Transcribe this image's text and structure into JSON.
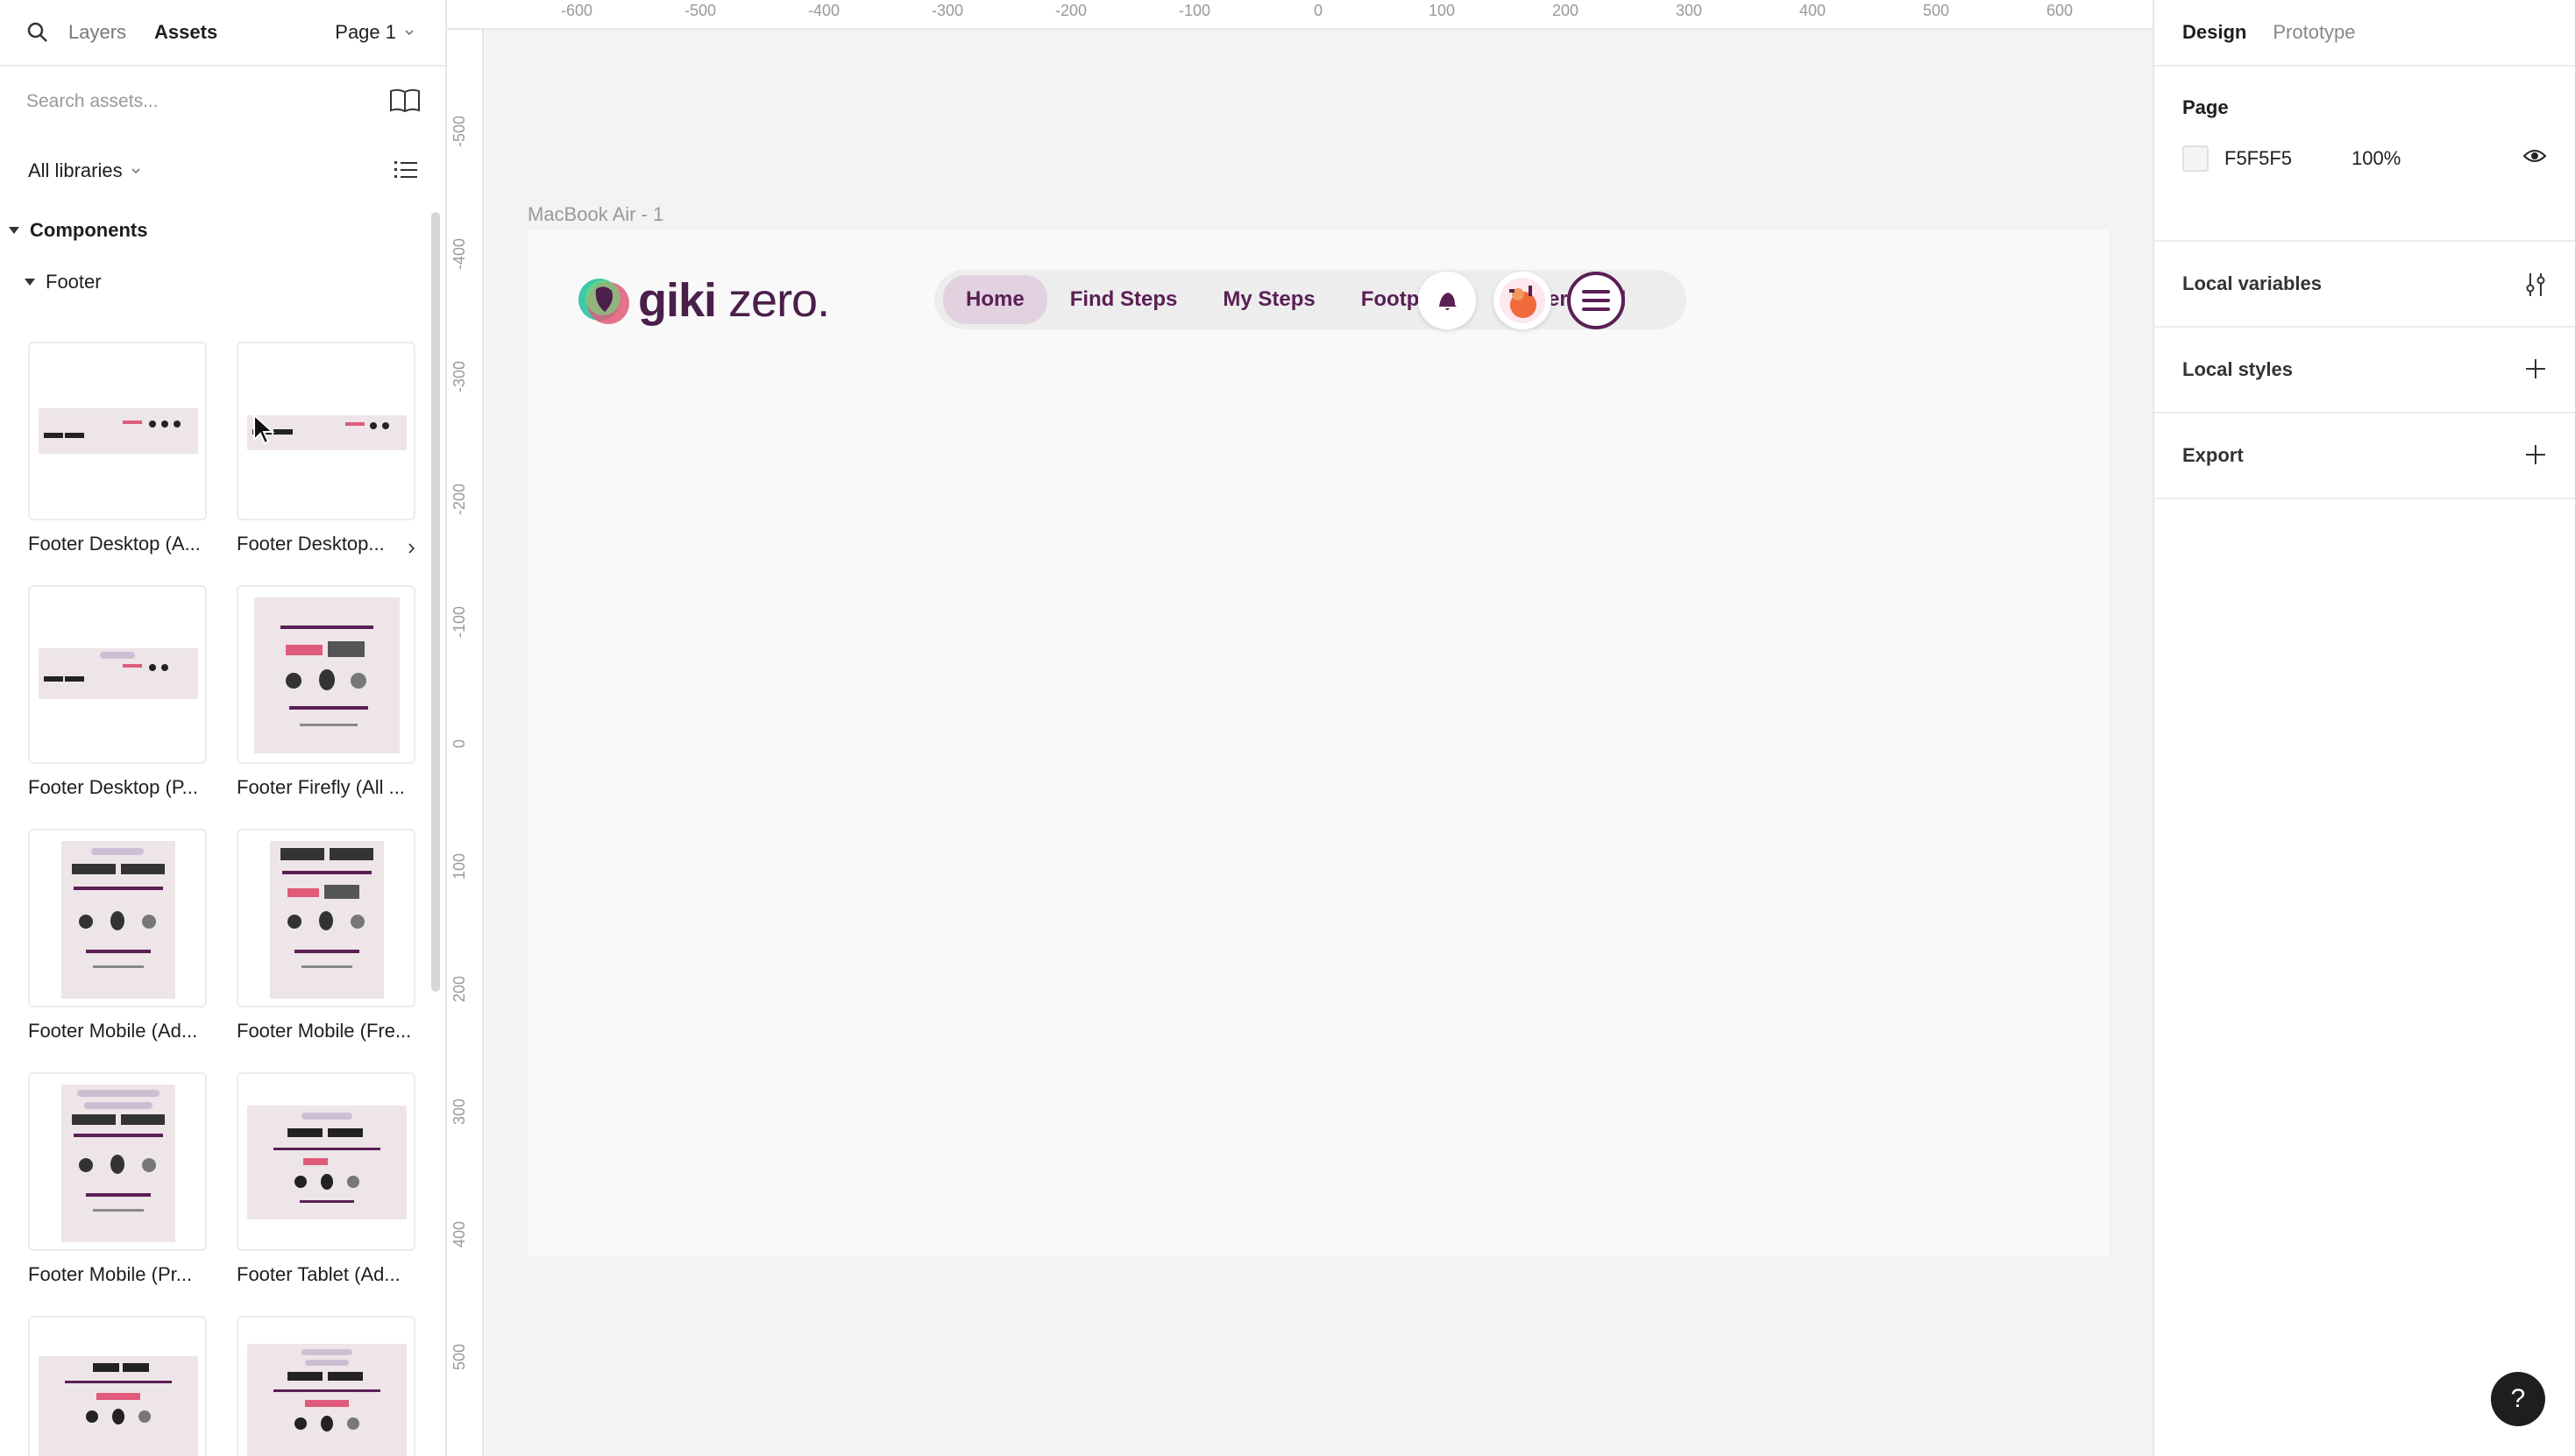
{
  "left_panel": {
    "tabs": [
      "Layers",
      "Assets"
    ],
    "page_selector": "Page 1",
    "search_placeholder": "Search assets...",
    "libraries_label": "All libraries",
    "section_title": "Components",
    "subsection_title": "Footer",
    "components": [
      "Footer Desktop (A...",
      "Footer Desktop...",
      "Footer Desktop (P...",
      "Footer Firefly (All ...",
      "Footer Mobile (Ad...",
      "Footer Mobile (Fre...",
      "Footer Mobile (Pr...",
      "Footer Tablet (Ad..."
    ]
  },
  "canvas": {
    "ruler_top": [
      "-600",
      "-500",
      "-400",
      "-300",
      "-200",
      "-100",
      "0",
      "100",
      "200",
      "300",
      "400",
      "500",
      "600"
    ],
    "ruler_left": [
      "-500",
      "-400",
      "-300",
      "-200",
      "-100",
      "0",
      "100",
      "200",
      "300",
      "400",
      "500"
    ],
    "frame_title": "MacBook Air - 1",
    "logo_text_bold": "giki",
    "logo_text_light": " zero.",
    "nav": [
      "Home",
      "Find Steps",
      "My Steps",
      "Footprint",
      "Leaderboard"
    ],
    "brand_color": "#5a1f55"
  },
  "right_panel": {
    "tabs": [
      "Design",
      "Prototype"
    ],
    "page_heading": "Page",
    "page_color": "F5F5F5",
    "page_opacity": "100%",
    "sections": [
      "Local variables",
      "Local styles",
      "Export"
    ]
  },
  "help_label": "?"
}
